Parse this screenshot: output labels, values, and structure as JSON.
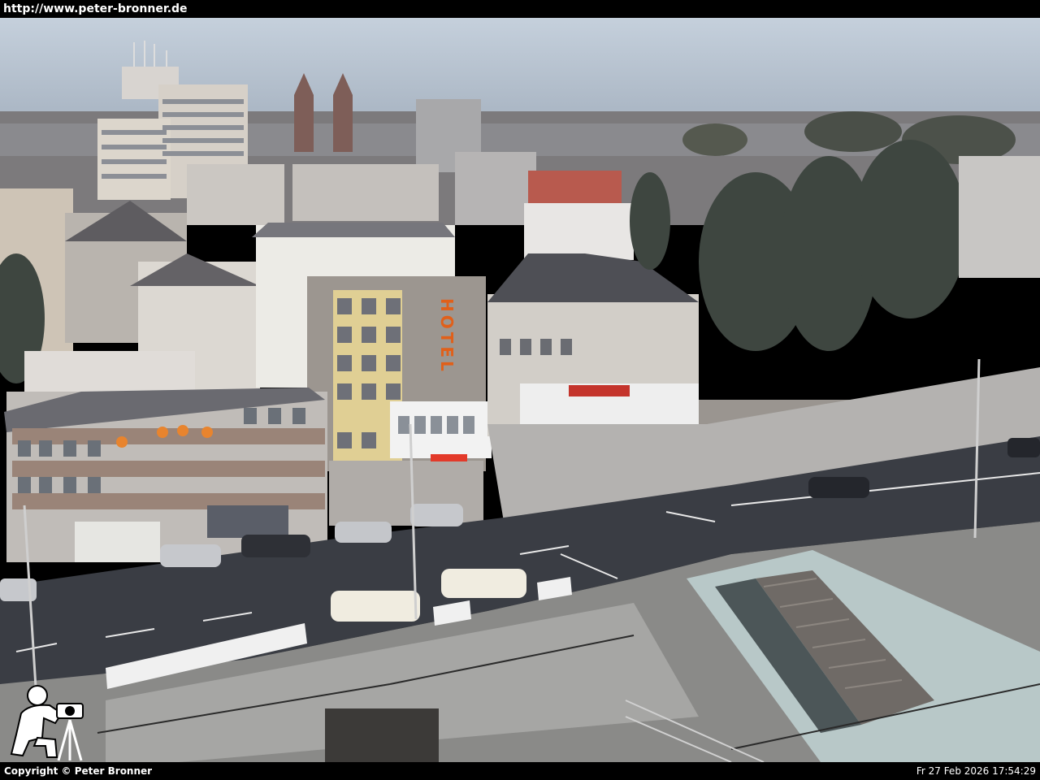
{
  "header": {
    "url_text": "http://www.peter-bronner.de"
  },
  "scene": {
    "hotel_sign": "HOTEL",
    "colors": {
      "sky": "#b8c6d4",
      "road": "#3a3d44",
      "hotel_sign": "#e0601a"
    }
  },
  "footer": {
    "copyright": "Copyright © Peter Bronner",
    "timestamp": "Fr 27 Feb 2026 17:54:29"
  },
  "icons": {
    "logo": "photographer-with-camera-icon"
  }
}
